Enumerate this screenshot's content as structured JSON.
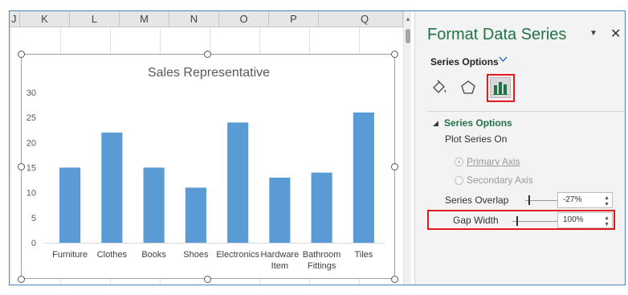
{
  "sheet": {
    "columns": [
      "J",
      "K",
      "L",
      "M",
      "N",
      "O",
      "P",
      "Q"
    ]
  },
  "chart_data": {
    "type": "bar",
    "title": "Sales Representative",
    "categories": [
      "Furniture",
      "Clothes",
      "Books",
      "Shoes",
      "Electronics",
      "Hardware Item",
      "Bathroom Fittings",
      "Tiles"
    ],
    "category_lines": [
      [
        "Furniture"
      ],
      [
        "Clothes"
      ],
      [
        "Books"
      ],
      [
        "Shoes"
      ],
      [
        "Electronics"
      ],
      [
        "Hardware",
        "Item"
      ],
      [
        "Bathroom",
        "Fittings"
      ],
      [
        "Tiles"
      ]
    ],
    "values": [
      15,
      22,
      15,
      11,
      24,
      13,
      14,
      26
    ],
    "yticks": [
      "0",
      "5",
      "10",
      "15",
      "20",
      "25",
      "30"
    ],
    "ylim": [
      0,
      30
    ],
    "grid": false,
    "bar_color": "#5b9bd5"
  },
  "pane": {
    "title": "Format Data Series",
    "series_options_label": "Series Options",
    "section_title": "Series Options",
    "plot_series_on": "Plot Series On",
    "primary_axis": "Primary Axis",
    "secondary_axis": "Secondary Axis",
    "series_overlap_label": "Series Overlap",
    "series_overlap_value": "-27%",
    "gap_width_label": "Gap Width",
    "gap_width_value": "100%",
    "accent_color": "#217346",
    "highlight_color": "#e01b1b"
  }
}
